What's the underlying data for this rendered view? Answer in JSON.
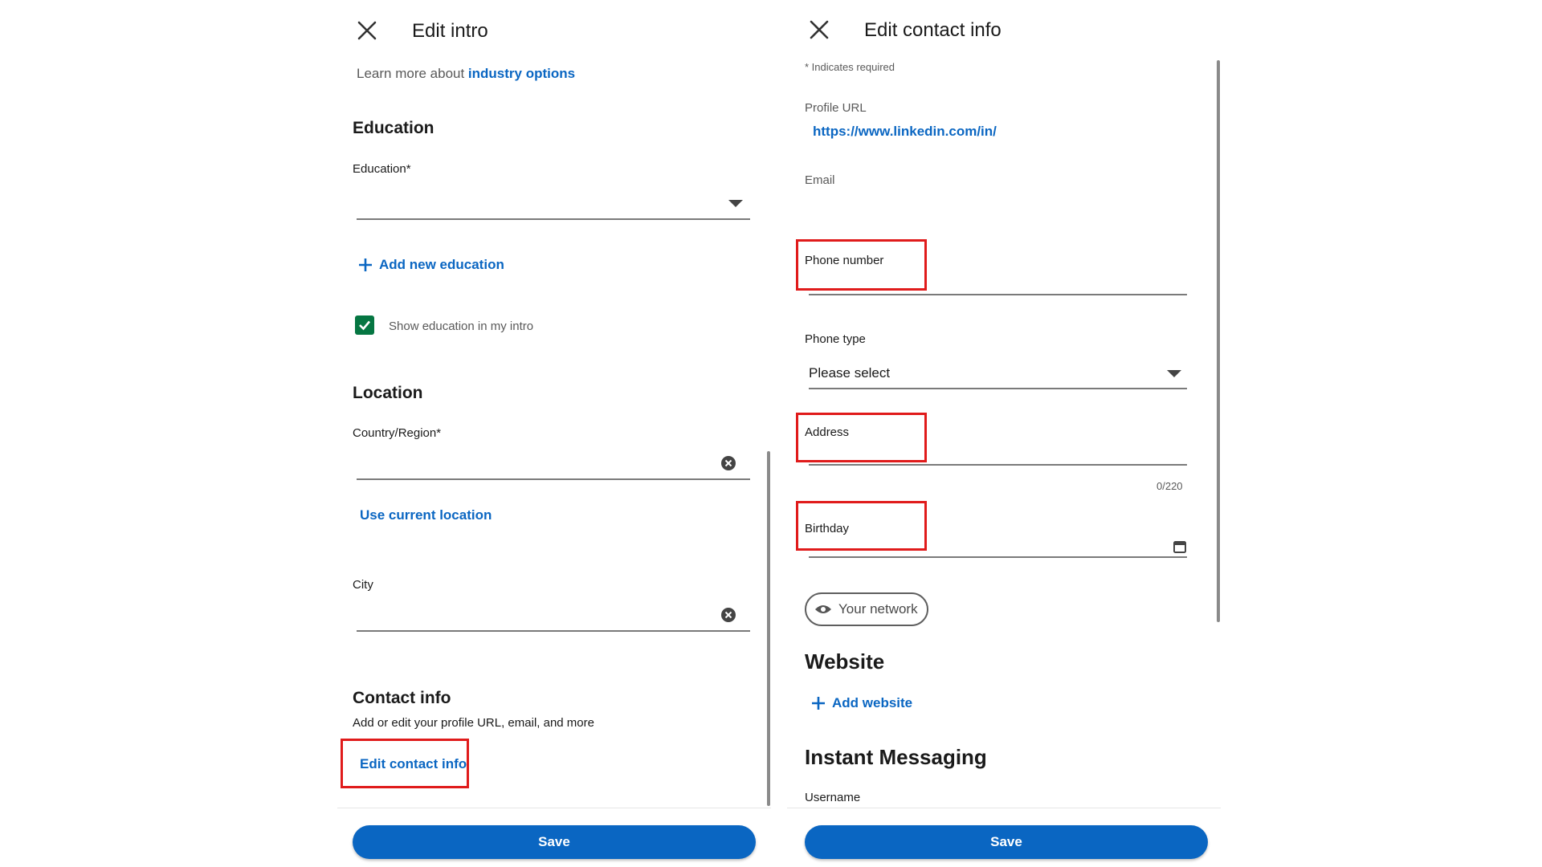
{
  "left": {
    "header": {
      "title": "Edit intro"
    },
    "learn_more": {
      "prefix": "Learn more about ",
      "link": "industry options"
    },
    "education": {
      "heading": "Education",
      "field_label": "Education*",
      "add_link": "Add new education",
      "show_checkbox_label": "Show education in my intro",
      "show_checked": true
    },
    "location": {
      "heading": "Location",
      "country_label": "Country/Region*",
      "use_current": "Use current location",
      "city_label": "City"
    },
    "contact": {
      "heading": "Contact info",
      "description": "Add or edit your profile URL, email, and more",
      "edit_link": "Edit contact info"
    },
    "save_label": "Save"
  },
  "right": {
    "header": {
      "title": "Edit contact info"
    },
    "required_note": "* Indicates required",
    "profile_url": {
      "label": "Profile URL",
      "value": "https://www.linkedin.com/in/"
    },
    "email": {
      "label": "Email"
    },
    "phone_number": {
      "label": "Phone number"
    },
    "phone_type": {
      "label": "Phone type",
      "value": "Please select"
    },
    "address": {
      "label": "Address",
      "counter": "0/220"
    },
    "birthday": {
      "label": "Birthday",
      "visibility": "Your network"
    },
    "website": {
      "heading": "Website",
      "add_link": "Add website"
    },
    "instant_messaging": {
      "heading": "Instant Messaging",
      "username_label": "Username"
    },
    "save_label": "Save"
  },
  "colors": {
    "link": "#0a66c2",
    "highlight": "#e01b1b",
    "checkbox": "#057642"
  }
}
